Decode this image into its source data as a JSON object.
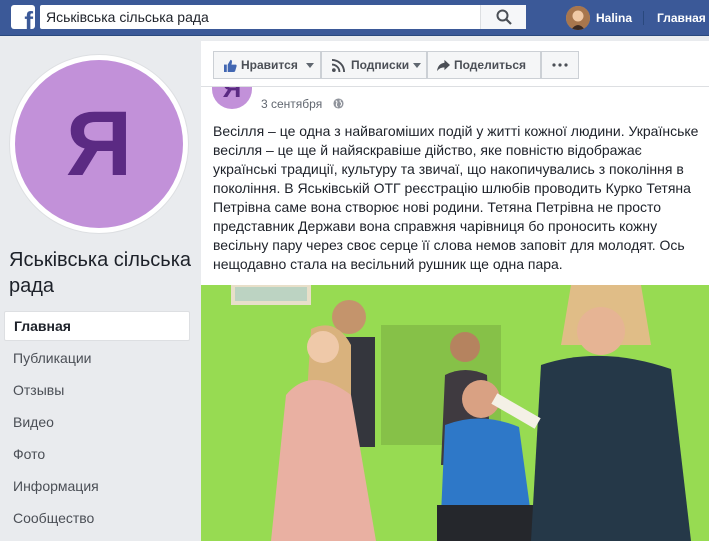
{
  "topbar": {
    "logo": "f",
    "search_value": "Яськівська сільська рада",
    "search_icon": "search-icon",
    "user_name": "Halina",
    "home_label": "Главная",
    "brand_color": "#3b5998"
  },
  "page": {
    "avatar_letter": "Я",
    "name": "Яськівська сільська рада"
  },
  "nav": {
    "items": [
      "Главная",
      "Публикации",
      "Отзывы",
      "Видео",
      "Фото",
      "Информация",
      "Сообщество"
    ],
    "active": "Главная"
  },
  "actions": {
    "like": "Нравится",
    "follow": "Подписки",
    "share": "Поделиться",
    "more_icon": "more-icon"
  },
  "post": {
    "avatar_letter": "Я",
    "date": "3 сентября",
    "audience_icon": "globe-icon",
    "text": "Весілля – це одна з найвагоміших подій у житті кожної людини. Українське весілля – це ще й найяскравіше дійство, яке повністю відображає українські традиції, культуру та звичаї, що накопичувались з покоління в покоління. В Яськівській ОТГ реєстрацію шлюбів проводить Курко Тетяна Петрівна саме вона створює нові родини. Тетяна Петрівна не просто представник Держави вона справжня чарівниця бо проносить кожну весільну пару через своє серце її слова немов заповіт для молодят. Ось нещодавно стала на весільний рушник ще одна пара."
  }
}
